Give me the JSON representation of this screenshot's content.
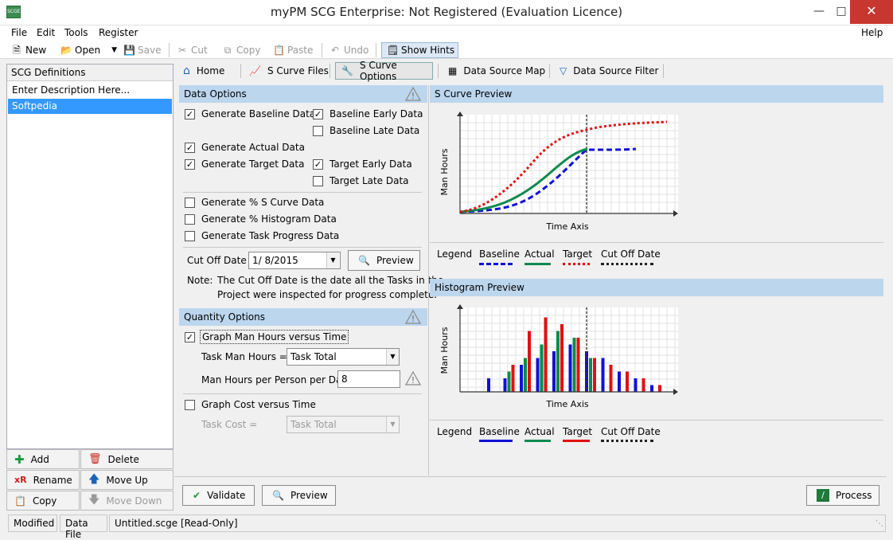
{
  "window": {
    "title": "myPM SCG Enterprise: Not Registered (Evaluation Licence)",
    "icon_text": "SCGE"
  },
  "menu": {
    "file": "File",
    "edit": "Edit",
    "tools": "Tools",
    "register": "Register",
    "help": "Help"
  },
  "toolbar": {
    "new": "New",
    "open": "Open",
    "save": "Save",
    "cut": "Cut",
    "copy": "Copy",
    "paste": "Paste",
    "undo": "Undo",
    "show_hints": "Show Hints"
  },
  "left": {
    "header": "SCG Definitions",
    "items": [
      "Enter Description Here...",
      "Softpedia"
    ],
    "add": "Add",
    "delete": "Delete",
    "rename": "Rename",
    "move_up": "Move Up",
    "copy": "Copy",
    "move_down": "Move Down"
  },
  "tabs": {
    "home": "Home",
    "s_curve_files": "S Curve Files",
    "s_curve_options": "S Curve Options",
    "data_source_map": "Data Source Map",
    "data_source_filter": "Data Source Filter"
  },
  "data_options": {
    "header": "Data Options",
    "generate_baseline": "Generate Baseline Data",
    "baseline_early": "Baseline Early Data",
    "baseline_late": "Baseline Late Data",
    "generate_actual": "Generate Actual Data",
    "generate_target": "Generate Target Data",
    "target_early": "Target Early Data",
    "target_late": "Target Late Data",
    "pct_s_curve": "Generate % S Curve Data",
    "pct_histogram": "Generate % Histogram Data",
    "task_progress": "Generate Task Progress Data",
    "cut_off_label": "Cut Off Date",
    "cut_off_value": "1/  8/2015",
    "preview": "Preview",
    "note_label": "Note:",
    "note_text_1": "The Cut Off Date is the date all the Tasks in the",
    "note_text_2": "Project were inspected for progress complete."
  },
  "quantity_options": {
    "header": "Quantity Options",
    "graph_hours": "Graph Man Hours versus Time",
    "task_hours_label": "Task Man Hours =",
    "task_hours_value": "Task Total",
    "per_person_label": "Man Hours per Person per Day",
    "per_person_value": "8",
    "graph_cost": "Graph Cost versus Time",
    "task_cost_label": "Task Cost =",
    "task_cost_value": "Task Total"
  },
  "scurve": {
    "header": "S Curve Preview",
    "ylabel": "Man Hours",
    "xlabel": "Time Axis"
  },
  "histogram": {
    "header": "Histogram Preview",
    "ylabel": "Man Hours",
    "xlabel": "Time Axis"
  },
  "legend": {
    "title": "Legend",
    "baseline": "Baseline",
    "actual": "Actual",
    "target": "Target",
    "cutoff": "Cut Off Date"
  },
  "colors": {
    "baseline": "#1010d8",
    "actual": "#0e8a4e",
    "target": "#e01010",
    "header_bg": "#bcd6ee"
  },
  "bottom": {
    "validate": "Validate",
    "preview": "Preview",
    "process": "Process"
  },
  "status": {
    "modified": "Modified",
    "data_file": "Data File",
    "file": "Untitled.scge [Read-Only]"
  },
  "chart_data": {
    "type": "bar",
    "series": [
      {
        "name": "Baseline",
        "values": [
          2,
          2,
          4,
          5,
          6,
          7,
          6,
          5,
          3,
          2,
          1
        ]
      },
      {
        "name": "Actual",
        "values": [
          0,
          3,
          5,
          7,
          9,
          8,
          5,
          0,
          0,
          0,
          0
        ]
      },
      {
        "name": "Target",
        "values": [
          0,
          4,
          9,
          11,
          10,
          8,
          5,
          4,
          3,
          2,
          1
        ]
      }
    ]
  }
}
